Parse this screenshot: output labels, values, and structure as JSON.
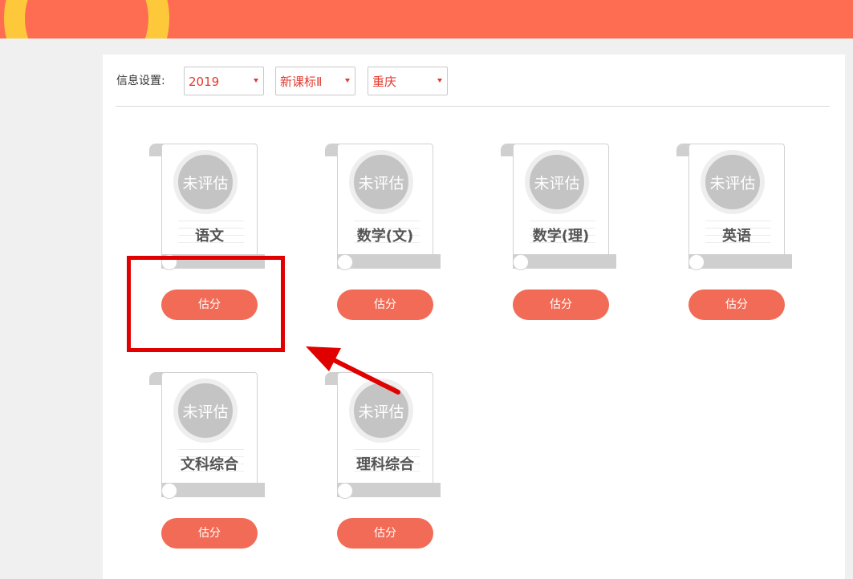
{
  "header": {
    "accent_color": "#fe6d52",
    "ring_color": "#fdc93b"
  },
  "settings": {
    "label": "信息设置:",
    "selects": [
      {
        "value": "2019"
      },
      {
        "value": "新课标Ⅱ"
      },
      {
        "value": "重庆"
      }
    ]
  },
  "subjects": [
    {
      "status": "未评估",
      "name": "语文",
      "button": "估分"
    },
    {
      "status": "未评估",
      "name": "数学(文)",
      "button": "估分"
    },
    {
      "status": "未评估",
      "name": "数学(理)",
      "button": "估分"
    },
    {
      "status": "未评估",
      "name": "英语",
      "button": "估分"
    },
    {
      "status": "未评估",
      "name": "文科综合",
      "button": "估分"
    },
    {
      "status": "未评估",
      "name": "理科综合",
      "button": "估分"
    }
  ],
  "annotation": {
    "color": "#e00000"
  }
}
